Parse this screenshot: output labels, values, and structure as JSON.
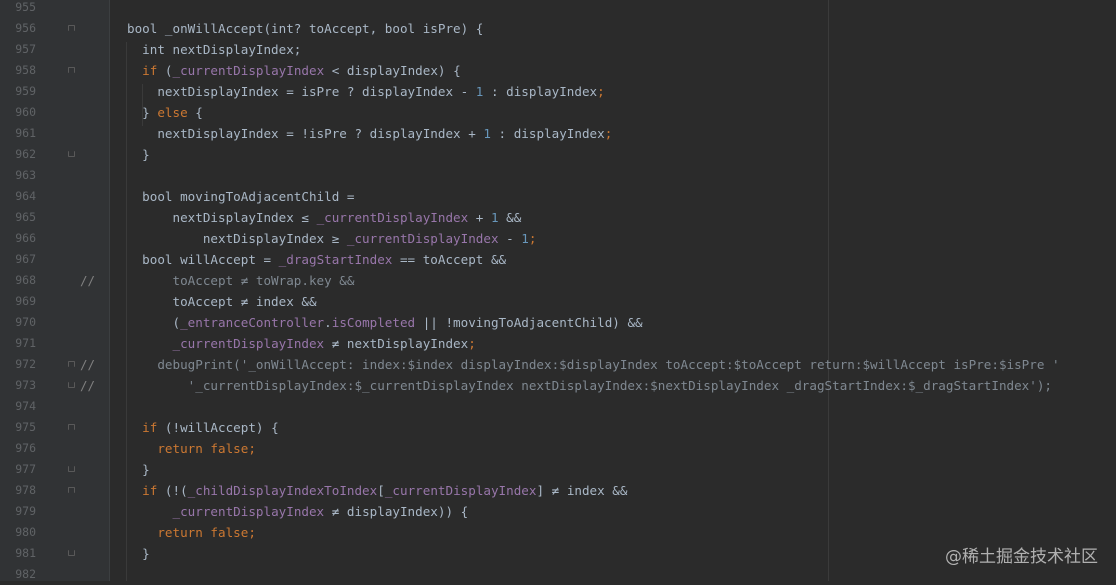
{
  "editor": {
    "lines": [
      {
        "n": "955",
        "marker": "",
        "fold": "",
        "segments": []
      },
      {
        "n": "956",
        "marker": "",
        "fold": "start",
        "segments": [
          [
            "t",
            "bool _onWillAccept(int? toAccept, bool isPre) {"
          ]
        ]
      },
      {
        "n": "957",
        "marker": "",
        "fold": "",
        "segments": [
          [
            "t",
            "  int nextDisplayIndex;"
          ]
        ]
      },
      {
        "n": "958",
        "marker": "",
        "fold": "start",
        "segments": [
          [
            "k",
            "  if "
          ],
          [
            "t",
            "("
          ],
          [
            "f",
            "_currentDisplayIndex"
          ],
          [
            "t",
            " < displayIndex) {"
          ]
        ]
      },
      {
        "n": "959",
        "marker": "",
        "fold": "",
        "segments": [
          [
            "t",
            "    nextDisplayIndex = isPre ? displayIndex - "
          ],
          [
            "n",
            "1"
          ],
          [
            "t",
            " : displayIndex"
          ],
          [
            "k",
            ";"
          ]
        ]
      },
      {
        "n": "960",
        "marker": "",
        "fold": "",
        "segments": [
          [
            "t",
            "  } "
          ],
          [
            "k",
            "else"
          ],
          [
            "t",
            " {"
          ]
        ]
      },
      {
        "n": "961",
        "marker": "",
        "fold": "",
        "segments": [
          [
            "t",
            "    nextDisplayIndex = !isPre ? displayIndex + "
          ],
          [
            "n",
            "1"
          ],
          [
            "t",
            " : displayIndex"
          ],
          [
            "k",
            ";"
          ]
        ]
      },
      {
        "n": "962",
        "marker": "",
        "fold": "end",
        "segments": [
          [
            "t",
            "  }"
          ]
        ]
      },
      {
        "n": "963",
        "marker": "",
        "fold": "",
        "segments": []
      },
      {
        "n": "964",
        "marker": "",
        "fold": "",
        "segments": [
          [
            "t",
            "  bool movingToAdjacentChild ="
          ]
        ]
      },
      {
        "n": "965",
        "marker": "",
        "fold": "",
        "segments": [
          [
            "t",
            "      nextDisplayIndex ≤ "
          ],
          [
            "f",
            "_currentDisplayIndex"
          ],
          [
            "t",
            " + "
          ],
          [
            "n",
            "1"
          ],
          [
            "t",
            " &&"
          ]
        ]
      },
      {
        "n": "966",
        "marker": "",
        "fold": "",
        "segments": [
          [
            "t",
            "          nextDisplayIndex ≥ "
          ],
          [
            "f",
            "_currentDisplayIndex"
          ],
          [
            "t",
            " - "
          ],
          [
            "n",
            "1"
          ],
          [
            "k",
            ";"
          ]
        ]
      },
      {
        "n": "967",
        "marker": "",
        "fold": "",
        "segments": [
          [
            "t",
            "  bool willAccept = "
          ],
          [
            "f",
            "_dragStartIndex"
          ],
          [
            "t",
            " == toAccept &&"
          ]
        ]
      },
      {
        "n": "968",
        "marker": "//",
        "fold": "",
        "segments": [
          [
            "d",
            "      toAccept ≠ toWrap.key &&"
          ]
        ]
      },
      {
        "n": "969",
        "marker": "",
        "fold": "",
        "segments": [
          [
            "t",
            "      toAccept ≠ index &&"
          ]
        ]
      },
      {
        "n": "970",
        "marker": "",
        "fold": "",
        "segments": [
          [
            "t",
            "      ("
          ],
          [
            "f",
            "_entranceController"
          ],
          [
            "t",
            "."
          ],
          [
            "f",
            "isCompleted"
          ],
          [
            "t",
            " || !movingToAdjacentChild) &&"
          ]
        ]
      },
      {
        "n": "971",
        "marker": "",
        "fold": "",
        "segments": [
          [
            "t",
            "      "
          ],
          [
            "f",
            "_currentDisplayIndex"
          ],
          [
            "t",
            " ≠ nextDisplayIndex"
          ],
          [
            "k",
            ";"
          ]
        ]
      },
      {
        "n": "972",
        "marker": "//",
        "fold": "start",
        "segments": [
          [
            "d",
            "    debugPrint('_onWillAccept: index:$index displayIndex:$displayIndex toAccept:$toAccept return:$willAccept isPre:$isPre '"
          ]
        ]
      },
      {
        "n": "973",
        "marker": "//",
        "fold": "end",
        "segments": [
          [
            "d",
            "        '_currentDisplayIndex:$_currentDisplayIndex nextDisplayIndex:$nextDisplayIndex _dragStartIndex:$_dragStartIndex');"
          ]
        ]
      },
      {
        "n": "974",
        "marker": "",
        "fold": "",
        "segments": []
      },
      {
        "n": "975",
        "marker": "",
        "fold": "start",
        "segments": [
          [
            "k",
            "  if "
          ],
          [
            "t",
            "(!willAccept) {"
          ]
        ]
      },
      {
        "n": "976",
        "marker": "",
        "fold": "",
        "segments": [
          [
            "k",
            "    return false;"
          ]
        ]
      },
      {
        "n": "977",
        "marker": "",
        "fold": "end",
        "segments": [
          [
            "t",
            "  }"
          ]
        ]
      },
      {
        "n": "978",
        "marker": "",
        "fold": "start",
        "segments": [
          [
            "k",
            "  if "
          ],
          [
            "t",
            "(!("
          ],
          [
            "f",
            "_childDisplayIndexToIndex"
          ],
          [
            "t",
            "["
          ],
          [
            "f",
            "_currentDisplayIndex"
          ],
          [
            "t",
            "] ≠ index &&"
          ]
        ]
      },
      {
        "n": "979",
        "marker": "",
        "fold": "",
        "segments": [
          [
            "t",
            "      "
          ],
          [
            "f",
            "_currentDisplayIndex"
          ],
          [
            "t",
            " ≠ displayIndex)) {"
          ]
        ]
      },
      {
        "n": "980",
        "marker": "",
        "fold": "",
        "segments": [
          [
            "k",
            "    return false;"
          ]
        ]
      },
      {
        "n": "981",
        "marker": "",
        "fold": "end",
        "segments": [
          [
            "t",
            "  }"
          ]
        ]
      },
      {
        "n": "982",
        "marker": "",
        "fold": "",
        "segments": []
      }
    ]
  },
  "watermark": "@稀土掘金技术社区",
  "colors": {
    "background": "#2b2b2b",
    "keyword": "#cc7832",
    "field": "#9876aa",
    "number": "#6897bb",
    "text": "#a9b7c6",
    "comment": "#808080"
  }
}
